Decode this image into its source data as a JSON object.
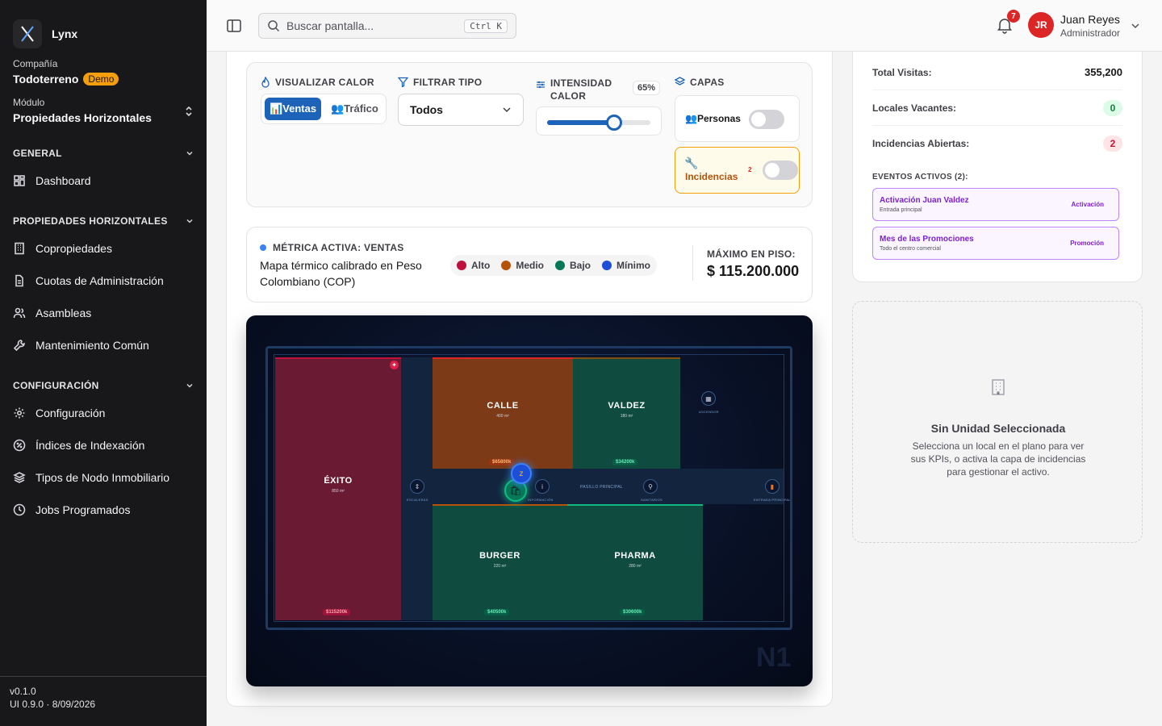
{
  "sidebar": {
    "brand": "Lynx",
    "company_label": "Compañía",
    "company_name": "Todoterreno",
    "company_badge": "Demo",
    "module_label": "Módulo",
    "module_name": "Propiedades Horizontales",
    "sections": [
      {
        "title": "GENERAL",
        "items": [
          {
            "label": "Dashboard",
            "icon": "grid-icon"
          }
        ]
      },
      {
        "title": "PROPIEDADES HORIZONTALES",
        "items": [
          {
            "label": "Copropiedades",
            "icon": "building-icon"
          },
          {
            "label": "Cuotas de Administración",
            "icon": "receipt-icon"
          },
          {
            "label": "Asambleas",
            "icon": "users-icon"
          },
          {
            "label": "Mantenimiento Común",
            "icon": "wrench-icon"
          }
        ]
      },
      {
        "title": "CONFIGURACIÓN",
        "items": [
          {
            "label": "Configuración",
            "icon": "gear-icon"
          },
          {
            "label": "Índices de Indexación",
            "icon": "percent-icon"
          },
          {
            "label": "Tipos de Nodo Inmobiliario",
            "icon": "layers-icon"
          },
          {
            "label": "Jobs Programados",
            "icon": "clock-icon"
          }
        ]
      }
    ],
    "version": "v0.1.0",
    "ui_version": "UI 0.9.0 · 8/09/2026"
  },
  "topbar": {
    "search_placeholder": "Buscar pantalla...",
    "search_shortcut": "Ctrl K",
    "notifications": "7",
    "avatar_initials": "JR",
    "user_name": "Juan Reyes",
    "user_role": "Administrador"
  },
  "controls": {
    "heat_title": "VISUALIZAR CALOR",
    "heat_options": [
      "📊Ventas",
      "👥Tráfico"
    ],
    "heat_selected": "Ventas",
    "filter_title": "FILTRAR TIPO",
    "filter_value": "Todos",
    "intensity_title_1": "INTENSIDAD",
    "intensity_title_2": "CALOR",
    "intensity_label": "65%",
    "intensity_value": 0.65,
    "layers_title": "CAPAS",
    "layer_people": "👥Personas",
    "layer_incidents": "Incidencias",
    "incidents_count": "2",
    "layer_people_on": false,
    "layer_incidents_on": false
  },
  "metric": {
    "title": "MÉTRICA ACTIVA: VENTAS",
    "description": "Mapa térmico calibrado en Peso Colombiano (COP)",
    "legend": [
      {
        "label": "Alto",
        "color": "#be123c"
      },
      {
        "label": "Medio",
        "color": "#b45309"
      },
      {
        "label": "Bajo",
        "color": "#047857"
      },
      {
        "label": "Mínimo",
        "color": "#1d4ed8"
      }
    ],
    "max_label": "MÁXIMO EN PISO:",
    "max_value": "$ 115.200.000"
  },
  "map": {
    "floor": "N1",
    "corridor": "PASILLO PRINCIPAL",
    "units": [
      {
        "name": "ÉXITO",
        "area": "850 m²",
        "value": "$115200k",
        "color": "#6b1a34"
      },
      {
        "name": "CALLE",
        "area": "400 m²",
        "value": "$65800k",
        "color": "#7c3a16"
      },
      {
        "name": "VALDEZ",
        "area": "180 m²",
        "value": "$34200k",
        "color": "#0f4c3f"
      },
      {
        "name": "BURGER",
        "area": "220 m²",
        "value": "$40500k",
        "color": "#0f4c3f"
      },
      {
        "name": "PHARMA",
        "area": "280 m²",
        "value": "$30600k",
        "color": "#0f4c3f"
      }
    ],
    "pois": [
      "ESCALERAS",
      "INFORMACIÓN",
      "SANITARIOS",
      "ENTRADA PRINCIPAL",
      "ASCENSOR"
    ]
  },
  "stats": {
    "total_visits_label": "Total Visitas:",
    "total_visits": "355,200",
    "vacant_label": "Locales Vacantes:",
    "vacant": "0",
    "incidents_label": "Incidencias Abiertas:",
    "incidents": "2",
    "events_title": "EVENTOS ACTIVOS (2):",
    "events": [
      {
        "title": "Activación Juan Valdez",
        "sub": "Entrada principal",
        "type": "Activación"
      },
      {
        "title": "Mes de las Promociones",
        "sub": "Todo el centro comercial",
        "type": "Promoción"
      }
    ]
  },
  "empty_state": {
    "title": "Sin Unidad Seleccionada",
    "text": "Selecciona un local en el plano para ver sus KPIs, o activa la capa de incidencias para gestionar el activo."
  }
}
